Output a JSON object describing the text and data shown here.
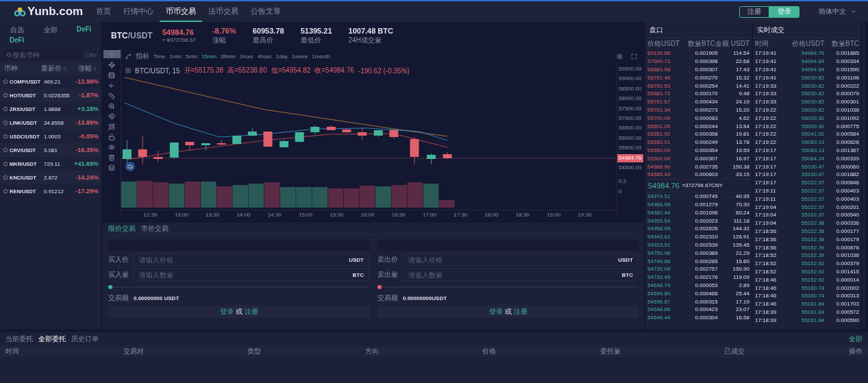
{
  "nav": {
    "logo": "Yunb.com",
    "items": [
      {
        "label": "首页",
        "selected": false
      },
      {
        "label": "行情中心",
        "selected": false
      },
      {
        "label": "币币交易",
        "selected": true
      },
      {
        "label": "法币交易",
        "selected": false
      },
      {
        "label": "公告文章",
        "selected": false
      }
    ],
    "register": "注册",
    "login": "登录",
    "language": "简体中文"
  },
  "market": {
    "tabs": [
      {
        "label": "自选",
        "selected": false
      },
      {
        "label": "全部",
        "selected": false
      },
      {
        "label": "DeFi",
        "selected": true
      },
      {
        "label": "DeFi",
        "selected": true
      }
    ],
    "search": {
      "placeholder": "搜索币种"
    },
    "currency": "CNY",
    "columns": [
      "币种",
      "最新价",
      "涨幅"
    ],
    "rows": [
      {
        "pair": "COMP/USDT",
        "price": "469.21",
        "change": "-12.98%",
        "color": "#e0606c"
      },
      {
        "pair": "HOT/USDT",
        "price": "0.0226355",
        "change": "-1.87%",
        "color": "#e0606c"
      },
      {
        "pair": "ZRX/USDT",
        "price": "1.8888",
        "change": "+3.18%",
        "color": "#43b59b"
      },
      {
        "pair": "LINK/USDT",
        "price": "34.8558",
        "change": "-13.89%",
        "color": "#e0606c"
      },
      {
        "pair": "USDC/USDT",
        "price": "1.0003",
        "change": "-0.05%",
        "color": "#e0606c"
      },
      {
        "pair": "CRV/USDT",
        "price": "3.081",
        "change": "-16.35%",
        "color": "#e0606c"
      },
      {
        "pair": "MKR/USDT",
        "price": "729.11",
        "change": "+41.69%",
        "color": "#43b59b"
      },
      {
        "pair": "KNC/USDT",
        "price": "2.872",
        "change": "-14.24%",
        "color": "#e0606c"
      },
      {
        "pair": "REN/USDT",
        "price": "0.91212",
        "change": "-17.29%",
        "color": "#e0606c"
      }
    ]
  },
  "ticker": {
    "base": "BTC",
    "quote": "/USDT",
    "price": "54984.76",
    "price_cny": "≈ ¥372796.67",
    "stats": [
      {
        "value": "-8.76%",
        "label": "涨幅",
        "color": "#e0606c"
      },
      {
        "value": "60953.78",
        "label": "最高价",
        "color": "#dfe3f0"
      },
      {
        "value": "51395.21",
        "label": "最低价",
        "color": "#dfe3f0"
      },
      {
        "value": "1007.48 BTC",
        "label": "24H成交量",
        "color": "#dfe3f0"
      }
    ]
  },
  "chart": {
    "indicator": "指标",
    "intervals": [
      {
        "label": "Time",
        "selected": false
      },
      {
        "label": "1min",
        "selected": false
      },
      {
        "label": "5min",
        "selected": false
      },
      {
        "label": "15min",
        "selected": true
      },
      {
        "label": "30min",
        "selected": false
      },
      {
        "label": "1hour",
        "selected": false
      },
      {
        "label": "4hour",
        "selected": false
      },
      {
        "label": "1day",
        "selected": false
      },
      {
        "label": "1week",
        "selected": false
      },
      {
        "label": "1month",
        "selected": false
      }
    ],
    "symbol": "BTC/USDT, 15",
    "legend": [
      "开=55175.38",
      "高=55238.80",
      "低=54954.82",
      "收=54984.76",
      "-190.62 (-0.35%)"
    ],
    "price_ticks": [
      "59500.00",
      "59000.00",
      "58500.00",
      "58000.00",
      "57500.00",
      "57000.00",
      "56500.00",
      "56000.00",
      "55500.00",
      "54500.00"
    ],
    "last_price": "54984.76",
    "volume_ticks": [
      "0.2",
      "0"
    ],
    "time_ticks": [
      "12:30",
      "13:00",
      "13:30",
      "14:00",
      "14:30",
      "15:00",
      "15:30",
      "16:00",
      "16:30",
      "17:00",
      "17:30",
      "18:00",
      "18:30",
      "19:00",
      "19:30"
    ]
  },
  "order_form": {
    "tabs": [
      {
        "label": "限价交易",
        "selected": true
      },
      {
        "label": "市价交易",
        "selected": false
      }
    ],
    "sides": [
      {
        "kind": "buy",
        "price_label": "买入价",
        "price_placeholder": "请输入价格",
        "price_unit": "USDT",
        "amount_label": "买入量",
        "amount_placeholder": "请输入数量",
        "amount_unit": "BTC",
        "level": 0,
        "total_label": "交易额",
        "total": "0.00000000 USDT",
        "login": "登录",
        "or": "或",
        "register": "注册"
      },
      {
        "kind": "sell",
        "price_label": "卖出价",
        "price_placeholder": "请输入价格",
        "price_unit": "USDT",
        "amount_label": "卖出量",
        "amount_placeholder": "请输入数量",
        "amount_unit": "BTC",
        "level": 0,
        "total_label": "交易额",
        "total": "0.00000000USDT",
        "login": "登录",
        "or": "或",
        "register": "注册"
      }
    ]
  },
  "order_book": {
    "title": "盘口",
    "columns": [
      "价格USDT",
      "数量BTC",
      "金额 USDT"
    ],
    "asks": [
      [
        "60126.86",
        "0.001905",
        "114.54"
      ],
      [
        "57000.72",
        "0.000398",
        "22.68"
      ],
      [
        "56881.98",
        "0.000307",
        "17.43"
      ],
      [
        "56751.46",
        "0.000270",
        "15.32"
      ],
      [
        "56750.59",
        "0.000254",
        "14.41"
      ],
      [
        "55881.72",
        "0.000170",
        "9.48"
      ],
      [
        "55751.67",
        "0.000434",
        "24.19"
      ],
      [
        "55701.34",
        "0.000273",
        "15.20"
      ],
      [
        "55700.00",
        "0.000083",
        "4.62"
      ],
      [
        "55501.05",
        "0.000244",
        "13.54"
      ],
      [
        "55351.92",
        "0.000358",
        "19.81"
      ],
      [
        "55350.91",
        "0.000249",
        "13.78"
      ],
      [
        "55350.00",
        "0.000354",
        "19.59"
      ],
      [
        "55300.04",
        "0.000307",
        "16.97"
      ],
      [
        "54986.90",
        "0.002735",
        "150.38"
      ],
      [
        "54985.43",
        "0.000603",
        "33.15"
      ]
    ],
    "last_price": "54984.76",
    "last_price_cny": "≈372796.67CNY",
    "bids": [
      [
        "54974.51",
        "0.000745",
        "40.95"
      ],
      [
        "54966.99",
        "0.001279",
        "70.30"
      ],
      [
        "54960.44",
        "0.001096",
        "60.24"
      ],
      [
        "54959.54",
        "0.002023",
        "111.18"
      ],
      [
        "54958.99",
        "0.002626",
        "144.32"
      ],
      [
        "54943.61",
        "0.002310",
        "126.91"
      ],
      [
        "54923.51",
        "0.002539",
        "139.45"
      ],
      [
        "54750.96",
        "0.000389",
        "21.29"
      ],
      [
        "54749.88",
        "0.000285",
        "15.60"
      ],
      [
        "54735.09",
        "0.002757",
        "150.90"
      ],
      [
        "54733.45",
        "0.002176",
        "119.09"
      ],
      [
        "54648.79",
        "0.000053",
        "2.89"
      ],
      [
        "54599.80",
        "0.000466",
        "25.44"
      ],
      [
        "54596.87",
        "0.000315",
        "17.19"
      ],
      [
        "54548.86",
        "0.000423",
        "23.07"
      ],
      [
        "54548.44",
        "0.000304",
        "16.58"
      ]
    ]
  },
  "trades": {
    "title": "实时成交",
    "columns": [
      "时间",
      "价格USDT",
      "数量BTC"
    ],
    "rows": [
      [
        "17:19:41",
        "54984.76",
        "0.001885"
      ],
      [
        "17:19:41",
        "54994.84",
        "0.000334"
      ],
      [
        "17:19:41",
        "54994.84",
        "0.001590"
      ],
      [
        "17:19:41",
        "55030.82",
        "0.001196"
      ],
      [
        "17:19:33",
        "55030.82",
        "0.000222"
      ],
      [
        "17:19:33",
        "55030.82",
        "0.000079"
      ],
      [
        "17:19:33",
        "55030.82",
        "0.000301"
      ],
      [
        "17:19:22",
        "55039.82",
        "0.001038"
      ],
      [
        "17:19:22",
        "55039.92",
        "0.001092"
      ],
      [
        "17:19:22",
        "55039.92",
        "0.000775"
      ],
      [
        "17:19:22",
        "55041.02",
        "0.000584"
      ],
      [
        "17:19:22",
        "55083.13",
        "0.000826"
      ],
      [
        "17:19:17",
        "55083.13",
        "0.001367"
      ],
      [
        "17:19:17",
        "55084.24",
        "0.000339"
      ],
      [
        "17:19:17",
        "55100.47",
        "0.000060"
      ],
      [
        "17:19:17",
        "55100.47",
        "0.001882"
      ],
      [
        "17:19:17",
        "55152.37",
        "0.000846"
      ],
      [
        "17:19:11",
        "55152.37",
        "0.000403"
      ],
      [
        "17:19:11",
        "55152.37",
        "0.000403"
      ],
      [
        "17:19:04",
        "55152.37",
        "0.000201"
      ],
      [
        "17:19:04",
        "55152.37",
        "0.000540"
      ],
      [
        "17:19:04",
        "55152.38",
        "0.000336"
      ],
      [
        "17:18:56",
        "55152.38",
        "0.000177"
      ],
      [
        "17:18:56",
        "55152.38",
        "0.000179"
      ],
      [
        "17:18:56",
        "55152.39",
        "0.000876"
      ],
      [
        "17:18:52",
        "55152.39",
        "0.001036"
      ],
      [
        "17:18:52",
        "55152.92",
        "0.000379"
      ],
      [
        "17:18:52",
        "55152.92",
        "0.001415"
      ],
      [
        "17:18:46",
        "55152.92",
        "0.000014"
      ],
      [
        "17:18:46",
        "55160.74",
        "0.002002"
      ],
      [
        "17:18:46",
        "55160.74",
        "0.000313"
      ],
      [
        "17:18:46",
        "55161.84",
        "0.001703"
      ],
      [
        "17:18:39",
        "55161.84",
        "0.000572"
      ],
      [
        "17:18:39",
        "55161.84",
        "0.000590"
      ]
    ]
  },
  "orders": {
    "tabs": [
      {
        "label": "当前委托",
        "selected": false
      },
      {
        "label": "全部委托",
        "selected": true
      },
      {
        "label": "历史订单",
        "selected": false
      }
    ],
    "action": "全部",
    "columns": [
      "时间",
      "交易对",
      "类型",
      "方向",
      "价格",
      "委托量",
      "已成交",
      "操作"
    ]
  }
}
